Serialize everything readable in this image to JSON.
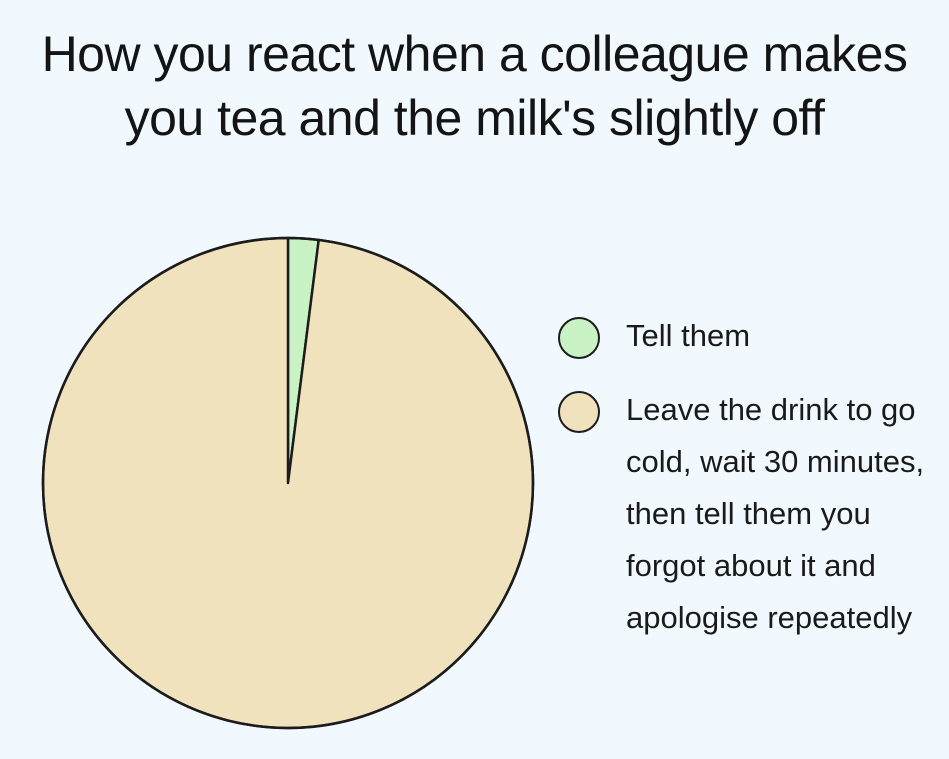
{
  "chart_data": {
    "type": "pie",
    "title_lines": [
      "How you react when a colleague makes",
      "you tea and the milk's slightly off"
    ],
    "slices": [
      {
        "label": "Tell them",
        "value": 2,
        "color": "#c9f2c5"
      },
      {
        "label": "Leave the drink to go cold, wait 30 minutes, then tell them you forgot about it and apologise repeatedly",
        "value": 98,
        "color": "#f1e2be"
      }
    ],
    "legend_position": "right",
    "outline_color": "#1c1c1c"
  }
}
